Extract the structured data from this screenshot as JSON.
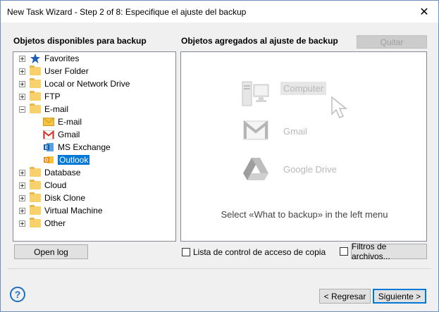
{
  "window": {
    "title": "New Task Wizard - Step 2 of 8: Especifique el ajuste del backup"
  },
  "left_panel": {
    "label": "Objetos disponibles para backup",
    "tree": [
      {
        "label": "Favorites",
        "icon": "star-icon",
        "expander": "plus"
      },
      {
        "label": "User Folder",
        "icon": "folder-icon",
        "expander": "plus"
      },
      {
        "label": "Local or Network Drive",
        "icon": "folder-icon",
        "expander": "plus"
      },
      {
        "label": "FTP",
        "icon": "folder-icon",
        "expander": "plus"
      },
      {
        "label": "E-mail",
        "icon": "folder-icon",
        "expander": "minus"
      },
      {
        "label": "E-mail",
        "icon": "envelope-icon",
        "child": true
      },
      {
        "label": "Gmail",
        "icon": "gmail-icon",
        "child": true
      },
      {
        "label": "MS Exchange",
        "icon": "exchange-icon",
        "child": true
      },
      {
        "label": "Outlook",
        "icon": "outlook-icon",
        "child": true,
        "selected": true
      },
      {
        "label": "Database",
        "icon": "folder-icon",
        "expander": "plus"
      },
      {
        "label": "Cloud",
        "icon": "folder-icon",
        "expander": "plus"
      },
      {
        "label": "Disk Clone",
        "icon": "folder-icon",
        "expander": "plus"
      },
      {
        "label": "Virtual Machine",
        "icon": "folder-icon",
        "expander": "plus"
      },
      {
        "label": "Other",
        "icon": "folder-icon",
        "expander": "plus"
      }
    ],
    "open_log_label": "Open log"
  },
  "right_panel": {
    "label": "Objetos agregados al ajuste de backup",
    "remove_label": "Quitar",
    "providers": [
      {
        "label": "Computer",
        "icon": "computer-icon"
      },
      {
        "label": "Gmail",
        "icon": "gmail-icon"
      },
      {
        "label": "Google Drive",
        "icon": "google-drive-icon"
      }
    ],
    "hint": "Select «What to backup» in the left menu",
    "acl_label": "Lista de control de acceso de copia",
    "filters_label": "Filtros de archivos..."
  },
  "footer": {
    "help_label": "?",
    "back_label": "< Regresar",
    "next_label": "Siguiente >"
  },
  "colors": {
    "accent": "#0078d7",
    "folder": "#f8d16c",
    "favorites_star": "#1e5fb4"
  }
}
